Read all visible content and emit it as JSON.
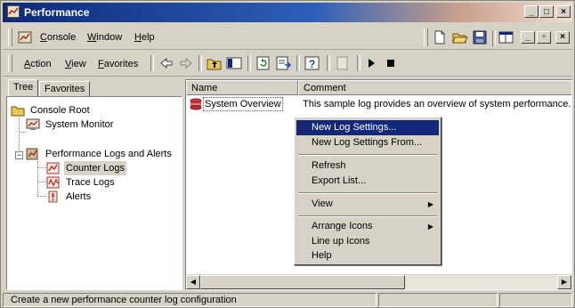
{
  "window": {
    "title": "Performance",
    "title_bar_color": "#0c2a78",
    "controls": [
      "_",
      "□",
      "×"
    ]
  },
  "menubar": {
    "items": [
      {
        "label": "Console",
        "mnemonic": "C"
      },
      {
        "label": "Window",
        "mnemonic": "W"
      },
      {
        "label": "Help",
        "mnemonic": "H"
      }
    ],
    "mdi_controls": [
      "_",
      "▫",
      "×"
    ]
  },
  "toolbar": {
    "menus": [
      {
        "label": "Action",
        "mnemonic": "A"
      },
      {
        "label": "View",
        "mnemonic": "V"
      },
      {
        "label": "Favorites",
        "mnemonic": "F"
      }
    ]
  },
  "tree": {
    "tabs": [
      {
        "label": "Tree"
      },
      {
        "label": "Favorites"
      }
    ],
    "nodes": [
      {
        "label": "Console Root",
        "icon": "folder-icon"
      },
      {
        "label": "System Monitor",
        "icon": "system-monitor-icon"
      },
      {
        "label": "Performance Logs and Alerts",
        "icon": "performance-logs-icon",
        "expander": "−"
      },
      {
        "label": "Counter Logs",
        "icon": "counter-logs-icon",
        "selected": true
      },
      {
        "label": "Trace Logs",
        "icon": "trace-logs-icon"
      },
      {
        "label": "Alerts",
        "icon": "alerts-icon"
      }
    ]
  },
  "list": {
    "columns": [
      "Name",
      "Comment"
    ],
    "rows": [
      {
        "name": "System Overview",
        "comment": "This sample log provides an overview of system performance.",
        "icon": "log-icon"
      }
    ]
  },
  "context_menu": {
    "highlight_color": "#14287a",
    "items": [
      {
        "label": "New Log Settings...",
        "highlighted": true
      },
      {
        "label": "New Log Settings From..."
      },
      {
        "label": "Refresh"
      },
      {
        "label": "Export List..."
      },
      {
        "label": "View",
        "submenu": true
      },
      {
        "label": "Arrange Icons",
        "submenu": true
      },
      {
        "label": "Line up Icons"
      },
      {
        "label": "Help"
      }
    ]
  },
  "statusbar": {
    "text": "Create a new performance counter log configuration"
  }
}
